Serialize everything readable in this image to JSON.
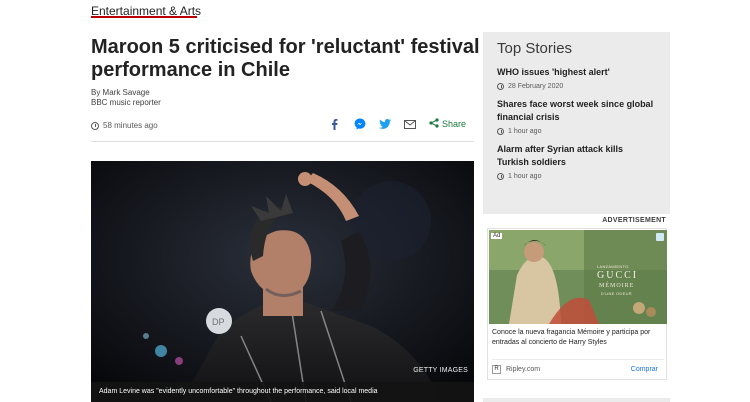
{
  "section": {
    "label": "Entertainment & Arts",
    "accent": "#b80000"
  },
  "article": {
    "headline": "Maroon 5 criticised for 'reluctant' festival performance in Chile",
    "byline": {
      "author": "By Mark Savage",
      "role": "BBC music reporter"
    },
    "timestamp": "58 minutes ago",
    "share": {
      "label": "Share",
      "icons": [
        "facebook-icon",
        "messenger-icon",
        "twitter-icon",
        "email-icon",
        "share-icon"
      ]
    },
    "image": {
      "credit": "GETTY IMAGES",
      "caption": "Adam Levine was \"evidently uncomfortable\" throughout the performance, said local media"
    }
  },
  "top_stories": {
    "title": "Top Stories",
    "items": [
      {
        "title": "WHO issues 'highest alert'",
        "time": "28 February 2020"
      },
      {
        "title": "Shares face worst week since global financial crisis",
        "time": "1 hour ago"
      },
      {
        "title": "Alarm after Syrian attack kills Turkish soldiers",
        "time": "1 hour ago"
      }
    ]
  },
  "advert": {
    "label": "ADVERTISEMENT",
    "badge": "Ad",
    "brand_small": "LANZAMIENTO",
    "brand": "GUCCI",
    "product": "MÉMOIRE",
    "product_sub": "D'UNE ODEUR",
    "text": "Conoce la nueva fragancia Mémoire y participa por entradas al concierto de Harry Styles",
    "domain": "Ripley.com",
    "logo_letter": "R",
    "cta": "Comprar"
  }
}
